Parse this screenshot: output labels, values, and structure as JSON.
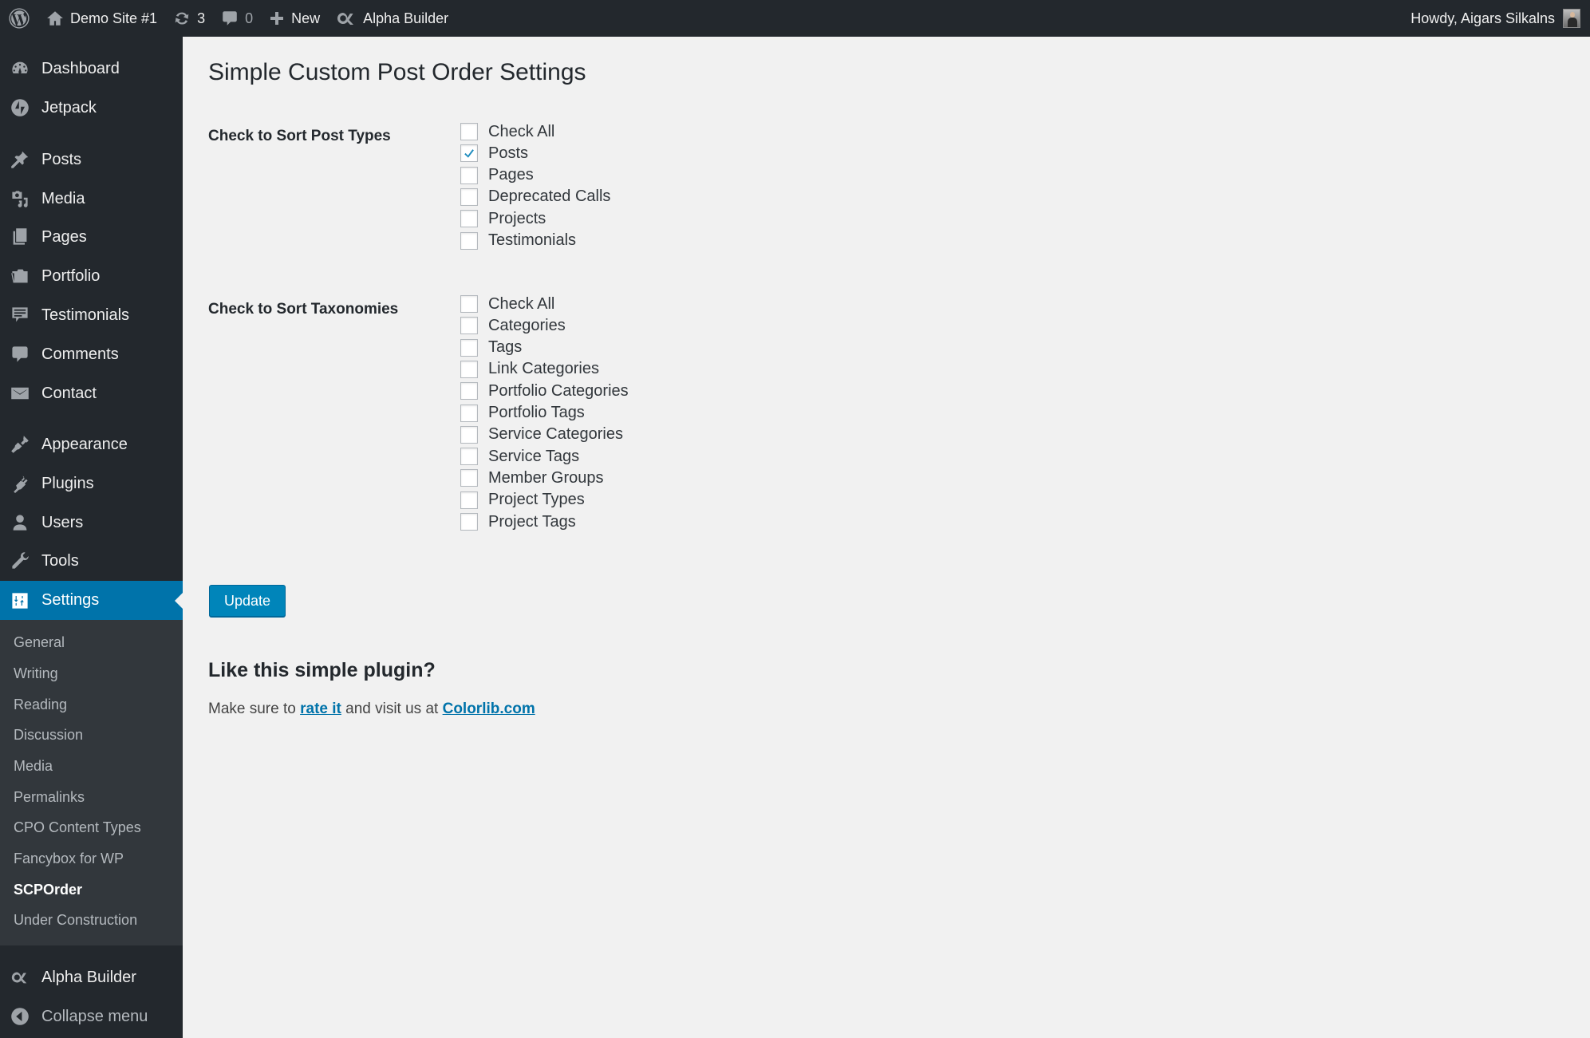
{
  "adminbar": {
    "site_name": "Demo Site #1",
    "updates_count": "3",
    "comments_count": "0",
    "new_label": "New",
    "builder_label": "Alpha Builder",
    "howdy": "Howdy, Aigars Silkalns"
  },
  "sidebar": {
    "items": [
      {
        "label": "Dashboard",
        "icon": "dashboard-icon"
      },
      {
        "label": "Jetpack",
        "icon": "jetpack-icon"
      },
      {
        "label": "Posts",
        "icon": "pin-icon"
      },
      {
        "label": "Media",
        "icon": "media-icon"
      },
      {
        "label": "Pages",
        "icon": "pages-icon"
      },
      {
        "label": "Portfolio",
        "icon": "folder-icon"
      },
      {
        "label": "Testimonials",
        "icon": "testimonial-icon"
      },
      {
        "label": "Comments",
        "icon": "comment-icon"
      },
      {
        "label": "Contact",
        "icon": "mail-icon"
      },
      {
        "label": "Appearance",
        "icon": "brush-icon"
      },
      {
        "label": "Plugins",
        "icon": "plug-icon"
      },
      {
        "label": "Users",
        "icon": "user-icon"
      },
      {
        "label": "Tools",
        "icon": "wrench-icon"
      },
      {
        "label": "Settings",
        "icon": "settings-icon",
        "current": true
      }
    ],
    "submenu": [
      "General",
      "Writing",
      "Reading",
      "Discussion",
      "Media",
      "Permalinks",
      "CPO Content Types",
      "Fancybox for WP",
      "SCPOrder",
      "Under Construction"
    ],
    "submenu_current": "SCPOrder",
    "builder_label": "Alpha Builder",
    "collapse_label": "Collapse menu"
  },
  "page": {
    "title": "Simple Custom Post Order Settings",
    "post_types_label": "Check to Sort Post Types",
    "post_types": [
      {
        "label": "Check All",
        "checked": false
      },
      {
        "label": "Posts",
        "checked": true
      },
      {
        "label": "Pages",
        "checked": false
      },
      {
        "label": "Deprecated Calls",
        "checked": false
      },
      {
        "label": "Projects",
        "checked": false
      },
      {
        "label": "Testimonials",
        "checked": false
      }
    ],
    "taxonomies_label": "Check to Sort Taxonomies",
    "taxonomies": [
      {
        "label": "Check All",
        "checked": false
      },
      {
        "label": "Categories",
        "checked": false
      },
      {
        "label": "Tags",
        "checked": false
      },
      {
        "label": "Link Categories",
        "checked": false
      },
      {
        "label": "Portfolio Categories",
        "checked": false
      },
      {
        "label": "Portfolio Tags",
        "checked": false
      },
      {
        "label": "Service Categories",
        "checked": false
      },
      {
        "label": "Service Tags",
        "checked": false
      },
      {
        "label": "Member Groups",
        "checked": false
      },
      {
        "label": "Project Types",
        "checked": false
      },
      {
        "label": "Project Tags",
        "checked": false
      }
    ],
    "update_label": "Update",
    "promo_heading": "Like this simple plugin?",
    "promo_text_1": "Make sure to ",
    "promo_link_1": "rate it",
    "promo_text_2": " and visit us at ",
    "promo_link_2": "Colorlib.com"
  },
  "colors": {
    "accent": "#0073aa",
    "button": "#0085ba",
    "sidebar_bg": "#23282d",
    "submenu_bg": "#32373c",
    "content_bg": "#f1f1f1"
  }
}
